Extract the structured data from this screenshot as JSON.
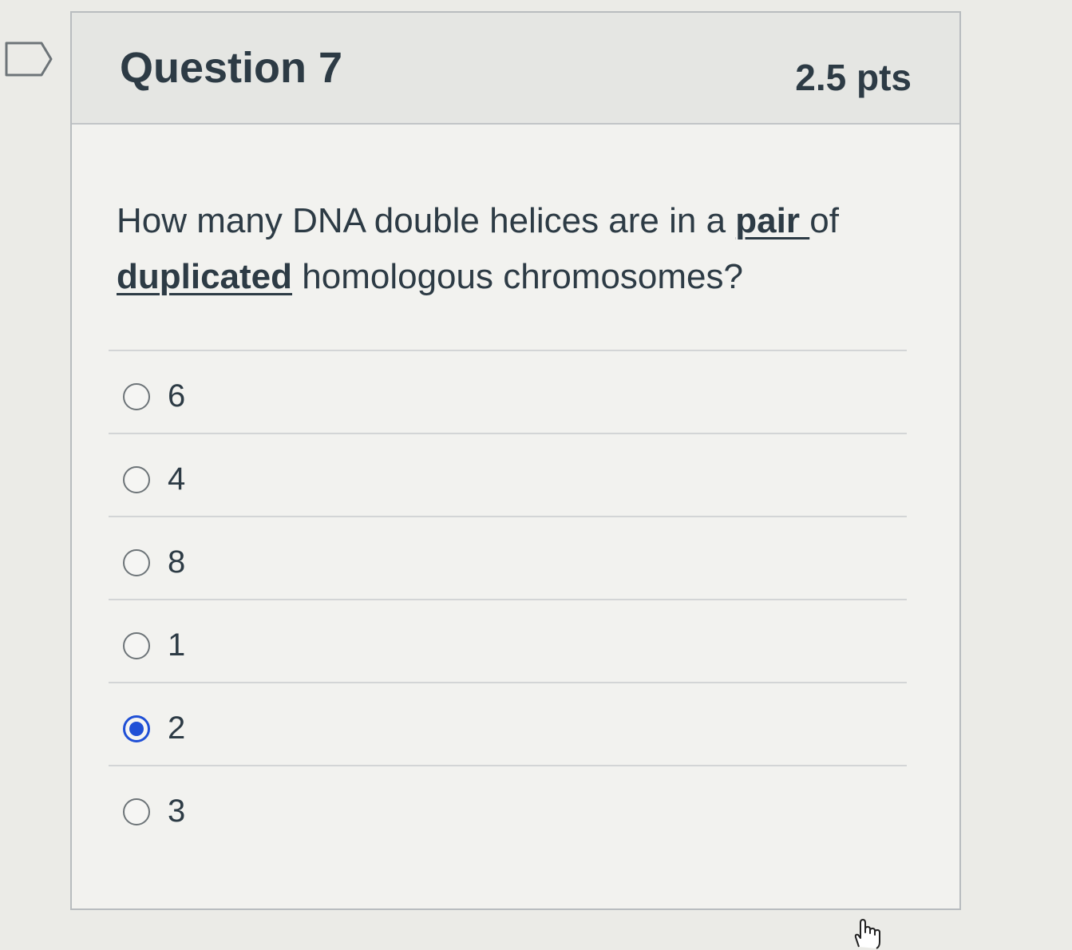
{
  "question": {
    "title": "Question 7",
    "points": "2.5 pts",
    "text_parts": {
      "p1": "How many DNA double helices are in a ",
      "p2": "pair ",
      "p3": "of ",
      "p4": "duplicated",
      "p5": " homologous chromosomes?"
    }
  },
  "answers": [
    {
      "label": "6",
      "selected": false
    },
    {
      "label": "4",
      "selected": false
    },
    {
      "label": "8",
      "selected": false
    },
    {
      "label": "1",
      "selected": false
    },
    {
      "label": "2",
      "selected": true
    },
    {
      "label": "3",
      "selected": false
    }
  ],
  "colors": {
    "accent": "#2050d6",
    "text": "#2d3b45"
  },
  "icons": {
    "flag": "bookmark-flag-icon",
    "cursor": "hand-pointer-icon"
  }
}
